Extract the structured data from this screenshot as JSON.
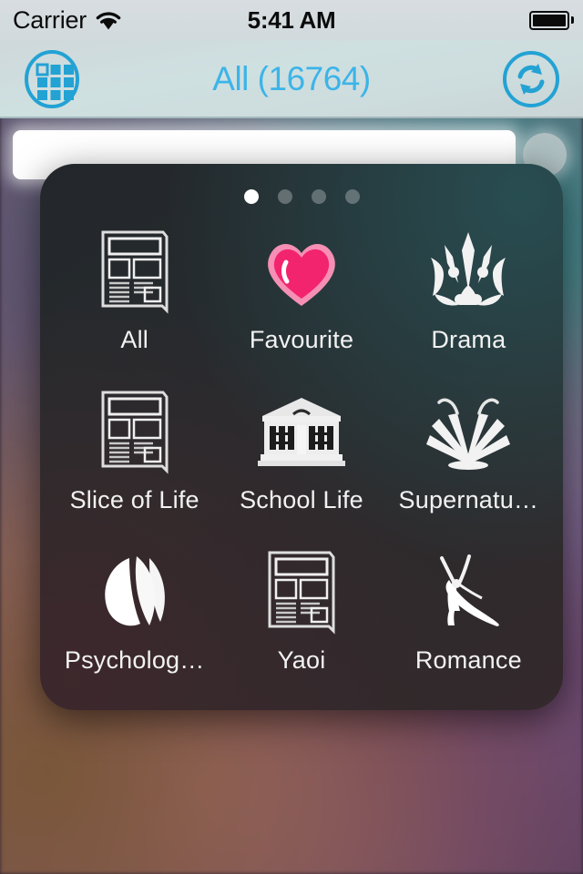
{
  "status_bar": {
    "carrier": "Carrier",
    "wifi_icon": "wifi-icon",
    "time": "5:41 AM",
    "battery_icon": "battery-full-icon"
  },
  "nav_bar": {
    "left_button": {
      "icon": "grid-view-icon",
      "name": "grid-view-button"
    },
    "title": "All (16764)",
    "title_color": "#3cb4e8",
    "right_button": {
      "icon": "refresh-sync-icon",
      "name": "refresh-button"
    }
  },
  "search": {
    "value": "",
    "placeholder": "",
    "mic_icon": "microphone-icon"
  },
  "panel": {
    "page_dots": {
      "count": 4,
      "active_index": 0
    },
    "genres": [
      {
        "label": "All",
        "icon": "newspaper-icon"
      },
      {
        "label": "Favourite",
        "icon": "heart-icon",
        "color": "#f2246e"
      },
      {
        "label": "Drama",
        "icon": "crown-ornament-icon"
      },
      {
        "label": "Slice of Life",
        "icon": "newspaper-icon"
      },
      {
        "label": "School Life",
        "icon": "school-building-icon"
      },
      {
        "label": "Supernatu…",
        "icon": "fountain-burst-icon"
      },
      {
        "label": "Psycholog…",
        "icon": "layered-petals-icon"
      },
      {
        "label": "Yaoi",
        "icon": "newspaper-icon"
      },
      {
        "label": "Romance",
        "icon": "high-heel-shoe-icon"
      }
    ]
  }
}
